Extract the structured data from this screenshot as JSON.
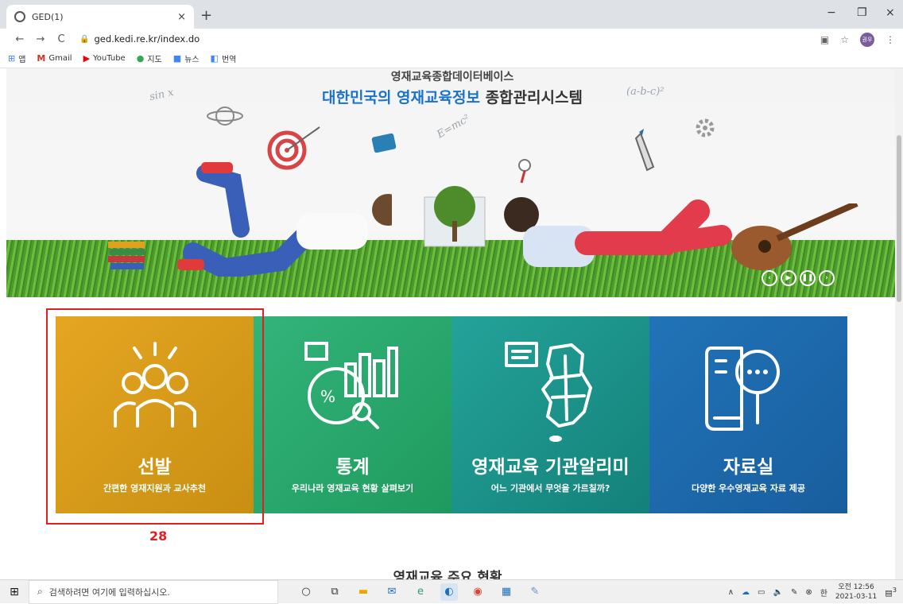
{
  "browser": {
    "tab_title": "GED(1)",
    "tab_close": "×",
    "new_tab": "+",
    "url": "ged.kedi.re.kr/index.do",
    "nav_back": "←",
    "nav_forward": "→",
    "nav_reload": "C",
    "window_minimize": "−",
    "window_restore": "❐",
    "window_close": "×",
    "profile_initial": "권우"
  },
  "bookmarks": [
    {
      "label": "앱",
      "icon": "apps-icon"
    },
    {
      "label": "Gmail",
      "icon": "gmail-icon"
    },
    {
      "label": "YouTube",
      "icon": "youtube-icon"
    },
    {
      "label": "지도",
      "icon": "maps-icon"
    },
    {
      "label": "뉴스",
      "icon": "news-icon"
    },
    {
      "label": "번역",
      "icon": "translate-icon"
    }
  ],
  "banner": {
    "subtitle": "영재교육종합데이터베이스",
    "headline_highlight": "대한민국의 영재교육정보",
    "headline_rest": "종합관리시스템"
  },
  "tiles": [
    {
      "title": "선발",
      "desc": "간편한 영재지원과 교사추천",
      "icon": "people-selection-icon",
      "color": "#d99a18"
    },
    {
      "title": "통계",
      "desc": "우리나라 영재교육 현황 살펴보기",
      "icon": "statistics-chart-icon",
      "color": "#28a86b"
    },
    {
      "title": "영재교육 기관알리미",
      "desc": "어느 기관에서 무엇을 가르칠까?",
      "icon": "korea-map-icon",
      "color": "#1c928a"
    },
    {
      "title": "자료실",
      "desc": "다양한 우수영재교육 자료 제공",
      "icon": "book-search-icon",
      "color": "#1f6aab"
    }
  ],
  "annotation": {
    "number": "28",
    "color": "#e02020"
  },
  "next_section_title": "영재교육 주요 현황",
  "taskbar": {
    "search_placeholder": "검색하려면 여기에 입력하십시오.",
    "time": "오전 12:56",
    "date": "2021-03-11",
    "ime": "한",
    "notification_count": "3"
  }
}
